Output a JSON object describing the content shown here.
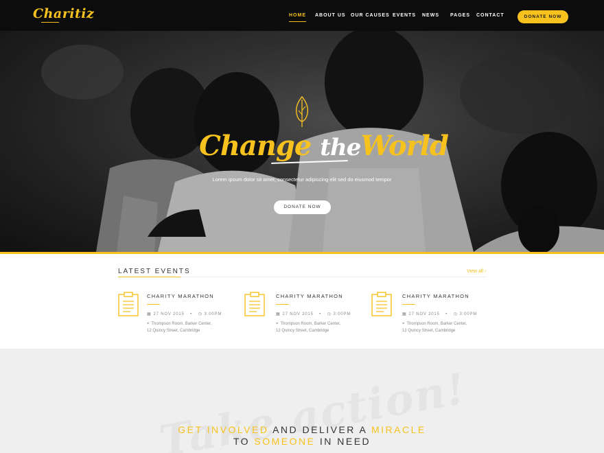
{
  "nav": {
    "logo": "Charitiz",
    "items": [
      "HOME",
      "ABOUT US",
      "OUR CAUSES",
      "EVENTS",
      "NEWS",
      "PAGES",
      "CONTACT"
    ],
    "active": "HOME",
    "donate_label": "DONATE NOW"
  },
  "hero": {
    "title_part1": "Change",
    "title_part2": "the",
    "title_part3": "World",
    "subtitle": "Lorem ipsum dolor sit amet, consectetur adipiscing elit sed do eiusmod tempor",
    "button_label": "DONATE NOW"
  },
  "events": {
    "title": "LATEST EVENTS",
    "view_all": "View all ›",
    "items": [
      {
        "name": "CHARITY MARATHON",
        "date": "27 NOV 2015",
        "time": "3:00PM",
        "address1": "Thompson Room, Barker Center,",
        "address2": "12 Quincy Street, Cambridge"
      },
      {
        "name": "CHARITY MARATHON",
        "date": "27 NOV 2015",
        "time": "3:00PM",
        "address1": "Thompson Room, Barker Center,",
        "address2": "12 Quincy Street, Cambridge"
      },
      {
        "name": "CHARITY MARATHON",
        "date": "27 NOV 2015",
        "time": "3:00PM",
        "address1": "Thompson Room, Barker Center,",
        "address2": "12 Quincy Street, Cambridge"
      }
    ]
  },
  "action": {
    "script": "Take action!",
    "w1": "GET INVOLVED",
    "w2": "AND DELIVER A",
    "w3": "MIRACLE",
    "w4": "TO",
    "w5": "SOMEONE",
    "w6": "IN NEED"
  },
  "colors": {
    "accent": "#f7c21e",
    "nav_bg": "#0c0c0c",
    "section_gray": "#efefef"
  }
}
